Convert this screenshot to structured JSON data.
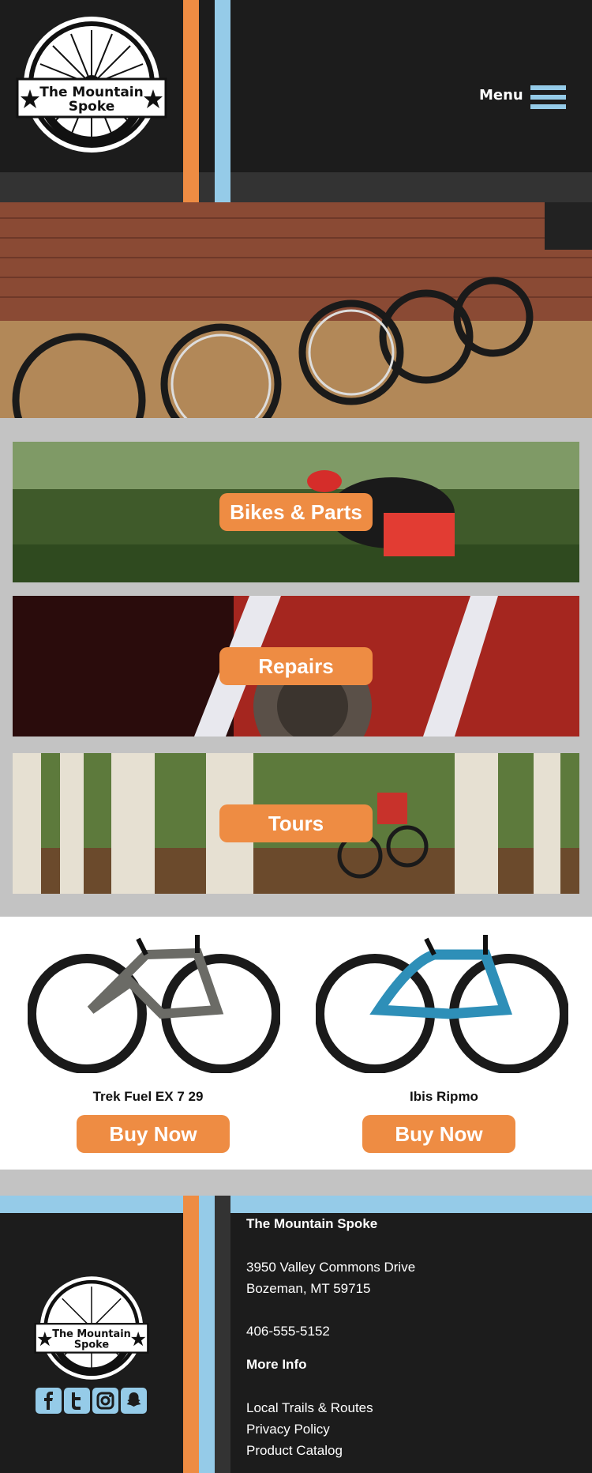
{
  "header": {
    "logo_line1": "The Mountain",
    "logo_line2": "Spoke",
    "menu_label": "Menu"
  },
  "categories": [
    {
      "label": "Bikes & Parts"
    },
    {
      "label": "Repairs"
    },
    {
      "label": "Tours"
    }
  ],
  "products": [
    {
      "name": "Trek Fuel EX 7 29",
      "button": "Buy Now",
      "frame_color": "#6b6b66"
    },
    {
      "name": "Ibis Ripmo",
      "button": "Buy Now",
      "frame_color": "#2e8fb8"
    }
  ],
  "footer": {
    "logo_line1": "The Mountain",
    "logo_line2": "Spoke",
    "company": "The Mountain Spoke",
    "address1": "3950 Valley Commons Drive",
    "address2": "Bozeman, MT 59715",
    "phone": "406-555-5152",
    "more_info_title": "More Info",
    "links": [
      "Local Trails & Routes",
      "Privacy Policy",
      "Product Catalog"
    ],
    "social": [
      "facebook-icon",
      "twitter-icon",
      "instagram-icon",
      "snapchat-icon"
    ]
  },
  "colors": {
    "accent_orange": "#ee8c43",
    "accent_blue": "#95cbe8",
    "dark_bg": "#1c1c1c"
  }
}
